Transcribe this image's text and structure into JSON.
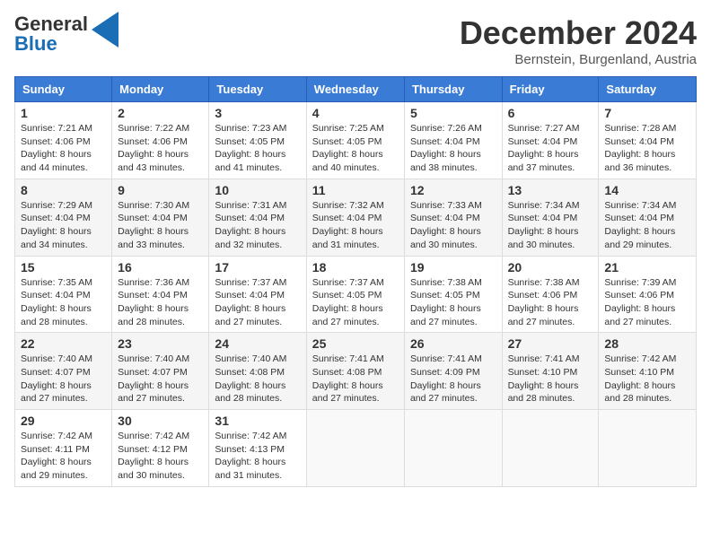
{
  "logo": {
    "line1": "General",
    "line2": "Blue"
  },
  "header": {
    "month": "December 2024",
    "location": "Bernstein, Burgenland, Austria"
  },
  "weekdays": [
    "Sunday",
    "Monday",
    "Tuesday",
    "Wednesday",
    "Thursday",
    "Friday",
    "Saturday"
  ],
  "weeks": [
    [
      {
        "day": "1",
        "sunrise": "7:21 AM",
        "sunset": "4:06 PM",
        "daylight": "8 hours and 44 minutes."
      },
      {
        "day": "2",
        "sunrise": "7:22 AM",
        "sunset": "4:06 PM",
        "daylight": "8 hours and 43 minutes."
      },
      {
        "day": "3",
        "sunrise": "7:23 AM",
        "sunset": "4:05 PM",
        "daylight": "8 hours and 41 minutes."
      },
      {
        "day": "4",
        "sunrise": "7:25 AM",
        "sunset": "4:05 PM",
        "daylight": "8 hours and 40 minutes."
      },
      {
        "day": "5",
        "sunrise": "7:26 AM",
        "sunset": "4:04 PM",
        "daylight": "8 hours and 38 minutes."
      },
      {
        "day": "6",
        "sunrise": "7:27 AM",
        "sunset": "4:04 PM",
        "daylight": "8 hours and 37 minutes."
      },
      {
        "day": "7",
        "sunrise": "7:28 AM",
        "sunset": "4:04 PM",
        "daylight": "8 hours and 36 minutes."
      }
    ],
    [
      {
        "day": "8",
        "sunrise": "7:29 AM",
        "sunset": "4:04 PM",
        "daylight": "8 hours and 34 minutes."
      },
      {
        "day": "9",
        "sunrise": "7:30 AM",
        "sunset": "4:04 PM",
        "daylight": "8 hours and 33 minutes."
      },
      {
        "day": "10",
        "sunrise": "7:31 AM",
        "sunset": "4:04 PM",
        "daylight": "8 hours and 32 minutes."
      },
      {
        "day": "11",
        "sunrise": "7:32 AM",
        "sunset": "4:04 PM",
        "daylight": "8 hours and 31 minutes."
      },
      {
        "day": "12",
        "sunrise": "7:33 AM",
        "sunset": "4:04 PM",
        "daylight": "8 hours and 30 minutes."
      },
      {
        "day": "13",
        "sunrise": "7:34 AM",
        "sunset": "4:04 PM",
        "daylight": "8 hours and 30 minutes."
      },
      {
        "day": "14",
        "sunrise": "7:34 AM",
        "sunset": "4:04 PM",
        "daylight": "8 hours and 29 minutes."
      }
    ],
    [
      {
        "day": "15",
        "sunrise": "7:35 AM",
        "sunset": "4:04 PM",
        "daylight": "8 hours and 28 minutes."
      },
      {
        "day": "16",
        "sunrise": "7:36 AM",
        "sunset": "4:04 PM",
        "daylight": "8 hours and 28 minutes."
      },
      {
        "day": "17",
        "sunrise": "7:37 AM",
        "sunset": "4:04 PM",
        "daylight": "8 hours and 27 minutes."
      },
      {
        "day": "18",
        "sunrise": "7:37 AM",
        "sunset": "4:05 PM",
        "daylight": "8 hours and 27 minutes."
      },
      {
        "day": "19",
        "sunrise": "7:38 AM",
        "sunset": "4:05 PM",
        "daylight": "8 hours and 27 minutes."
      },
      {
        "day": "20",
        "sunrise": "7:38 AM",
        "sunset": "4:06 PM",
        "daylight": "8 hours and 27 minutes."
      },
      {
        "day": "21",
        "sunrise": "7:39 AM",
        "sunset": "4:06 PM",
        "daylight": "8 hours and 27 minutes."
      }
    ],
    [
      {
        "day": "22",
        "sunrise": "7:40 AM",
        "sunset": "4:07 PM",
        "daylight": "8 hours and 27 minutes."
      },
      {
        "day": "23",
        "sunrise": "7:40 AM",
        "sunset": "4:07 PM",
        "daylight": "8 hours and 27 minutes."
      },
      {
        "day": "24",
        "sunrise": "7:40 AM",
        "sunset": "4:08 PM",
        "daylight": "8 hours and 28 minutes."
      },
      {
        "day": "25",
        "sunrise": "7:41 AM",
        "sunset": "4:08 PM",
        "daylight": "8 hours and 27 minutes."
      },
      {
        "day": "26",
        "sunrise": "7:41 AM",
        "sunset": "4:09 PM",
        "daylight": "8 hours and 27 minutes."
      },
      {
        "day": "27",
        "sunrise": "7:41 AM",
        "sunset": "4:10 PM",
        "daylight": "8 hours and 28 minutes."
      },
      {
        "day": "28",
        "sunrise": "7:42 AM",
        "sunset": "4:10 PM",
        "daylight": "8 hours and 28 minutes."
      }
    ],
    [
      {
        "day": "29",
        "sunrise": "7:42 AM",
        "sunset": "4:11 PM",
        "daylight": "8 hours and 29 minutes."
      },
      {
        "day": "30",
        "sunrise": "7:42 AM",
        "sunset": "4:12 PM",
        "daylight": "8 hours and 30 minutes."
      },
      {
        "day": "31",
        "sunrise": "7:42 AM",
        "sunset": "4:13 PM",
        "daylight": "8 hours and 31 minutes."
      },
      null,
      null,
      null,
      null
    ]
  ]
}
